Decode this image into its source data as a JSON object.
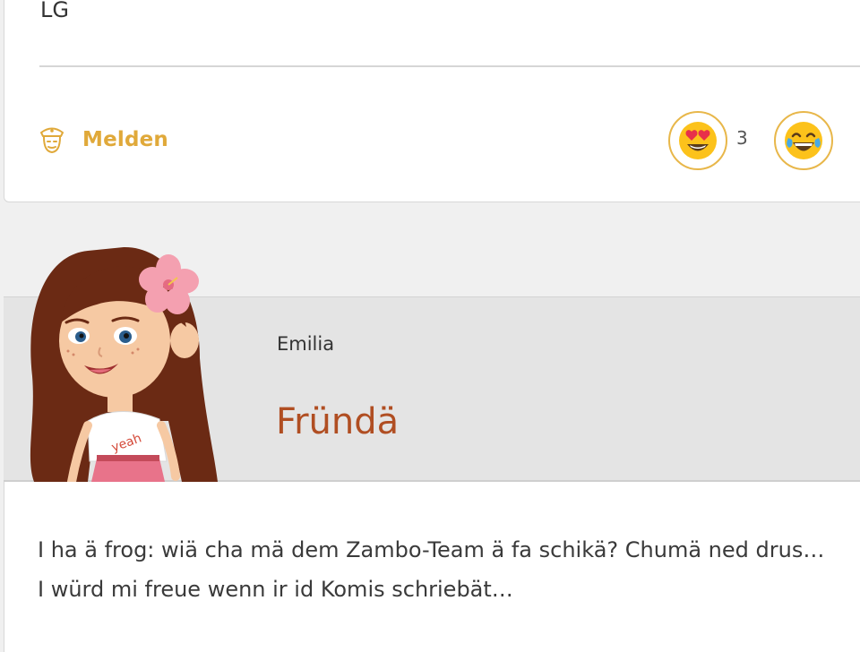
{
  "previous_post": {
    "text_fragment": "LG",
    "report_label": "Melden",
    "report_icon": "police-officer-icon",
    "reactions": [
      {
        "icon": "heart-eyes-emoji-icon",
        "count": "3"
      },
      {
        "icon": "tears-of-joy-emoji-icon",
        "count": ""
      }
    ]
  },
  "post": {
    "author": "Emilia",
    "title": "Fründä",
    "avatar_icon": "girl-avatar-icon",
    "body_lines": [
      "I ha ä frog: wiä cha mä dem Zambo-Team ä fa schikä? Chumä ned drus…",
      "I würd mi freue wenn ir id Komis schriebät…"
    ]
  },
  "colors": {
    "accent_gold": "#e0a93a",
    "title_brown": "#b04e22",
    "header_gray": "#e4e4e4",
    "page_bg": "#f0f0f0"
  }
}
